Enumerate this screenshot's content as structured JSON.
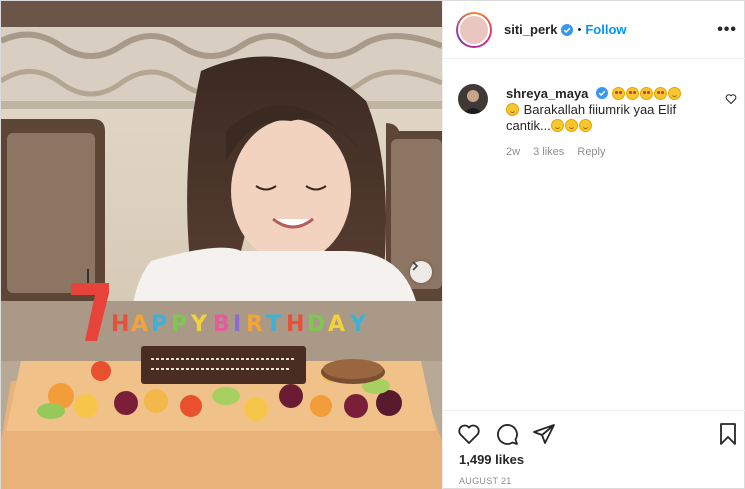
{
  "header": {
    "username": "siti_perk",
    "separator": "•",
    "follow_label": "Follow",
    "more_label": "•••"
  },
  "photo": {
    "candle_number": "7",
    "candle_letters": [
      "H",
      "A",
      "P",
      "P",
      "Y",
      "B",
      "I",
      "R",
      "T",
      "H",
      "D",
      "A",
      "Y"
    ],
    "candle_colors": [
      "#e8503a",
      "#f2a33a",
      "#3bb1d8",
      "#7ec850",
      "#f2d23a",
      "#e85a9e",
      "#8a6ad8",
      "#f2a33a",
      "#3bb1d8",
      "#e8503a",
      "#7ec850",
      "#f2d23a",
      "#3bb1d8"
    ],
    "next_icon": "chevron-right-icon"
  },
  "comment": {
    "username": "shreya_maya",
    "text_line1": "Barakallah fiiumrik yaa Elif",
    "text_line2": "cantik...",
    "time": "2w",
    "likes": "3 likes",
    "reply_label": "Reply"
  },
  "actions": {
    "icons": [
      "heart-icon",
      "comment-icon",
      "share-icon",
      "bookmark-icon"
    ],
    "likes_count": "1,499 likes",
    "date": "AUGUST 21"
  },
  "colors": {
    "accent": "#0095f6",
    "verified": "#3897f0",
    "muted": "#8e8e8e"
  }
}
